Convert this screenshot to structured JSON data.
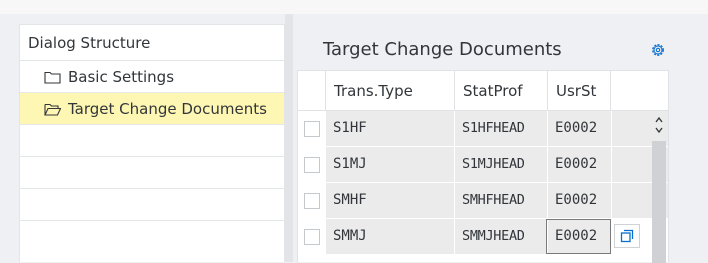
{
  "left_panel": {
    "header": "Dialog Structure",
    "items": [
      {
        "label": "Basic Settings",
        "selected": false,
        "icon": "folder-icon"
      },
      {
        "label": "Target Change Documents",
        "selected": true,
        "icon": "folder-open-icon"
      }
    ]
  },
  "main": {
    "title": "Target Change Documents",
    "settings_icon": "gear-icon",
    "columns": [
      "Trans.Type",
      "StatProf",
      "UsrSt"
    ],
    "rows": [
      {
        "trans_type": "S1HF",
        "stat_prof": "S1HFHEAD",
        "usr_st": "E0002"
      },
      {
        "trans_type": "S1MJ",
        "stat_prof": "S1MJHEAD",
        "usr_st": "E0002"
      },
      {
        "trans_type": "SMHF",
        "stat_prof": "SMHFHEAD",
        "usr_st": "E0002"
      },
      {
        "trans_type": "SMMJ",
        "stat_prof": "SMMJHEAD",
        "usr_st": "E0002"
      }
    ],
    "value_help_icon": "value-help-icon"
  },
  "colors": {
    "selected_row": "#fef7b3",
    "cell_bg": "#ebebeb",
    "panel_bg": "#eef0f3"
  }
}
